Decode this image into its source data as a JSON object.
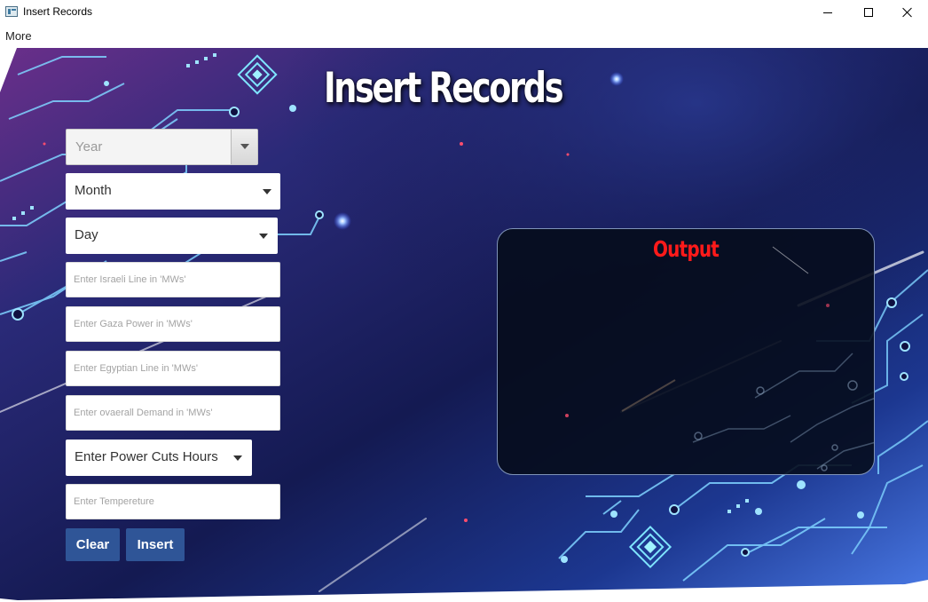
{
  "window": {
    "title": "Insert Records",
    "icon": "app-window-icon",
    "controls": [
      "minimize-icon",
      "maximize-icon",
      "close-icon"
    ]
  },
  "menu": {
    "items": [
      "More"
    ]
  },
  "heading": "Insert Records",
  "form": {
    "year": {
      "placeholder": "Year"
    },
    "month": {
      "value": "Month"
    },
    "day": {
      "value": "Day"
    },
    "israeli_line": {
      "placeholder": "Enter Israeli Line in 'MWs'"
    },
    "gaza_power": {
      "placeholder": "Enter Gaza Power in 'MWs'"
    },
    "egyptian_line": {
      "placeholder": "Enter Egyptian Line in 'MWs'"
    },
    "overall_demand": {
      "placeholder": "Enter ovaerall Demand in 'MWs'"
    },
    "power_cuts": {
      "value": "Enter Power Cuts Hours"
    },
    "temperature": {
      "placeholder": "Enter Tempereture"
    }
  },
  "buttons": {
    "clear": "Clear",
    "insert": "Insert"
  },
  "output": {
    "title": "Output",
    "content": ""
  },
  "colors": {
    "button": "#2f5597",
    "output_title": "#ff1a1a",
    "background_dark": "#141a52",
    "background_accent": "#6a2f8a"
  }
}
